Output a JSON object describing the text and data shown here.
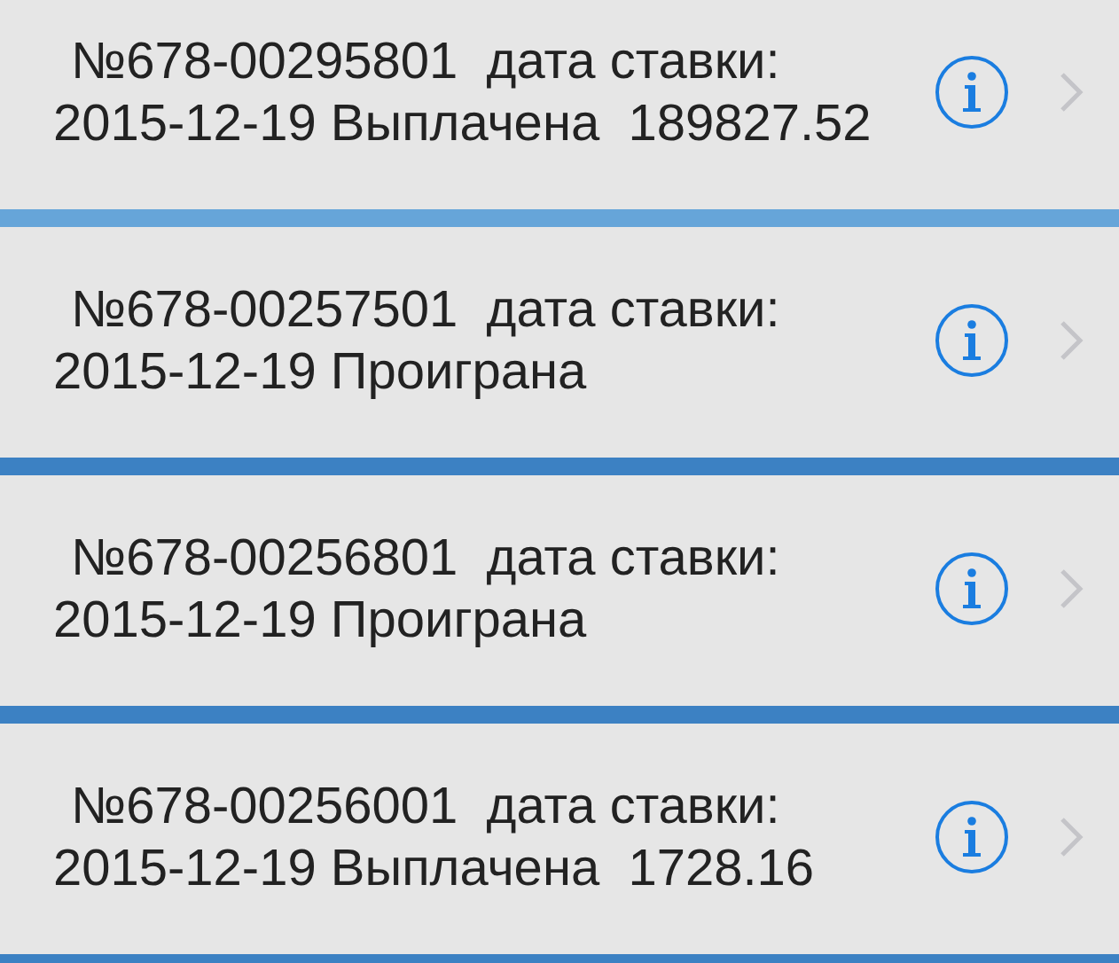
{
  "bets": [
    {
      "line1": "№678-00295801  дата ставки:",
      "line2": "2015-12-19 Выплачена  189827.52"
    },
    {
      "line1": "№678-00257501  дата ставки:",
      "line2": "2015-12-19 Проиграна"
    },
    {
      "line1": "№678-00256801  дата ставки:",
      "line2": "2015-12-19 Проиграна"
    },
    {
      "line1": "№678-00256001  дата ставки:",
      "line2": "2015-12-19 Выплачена  1728.16"
    }
  ]
}
